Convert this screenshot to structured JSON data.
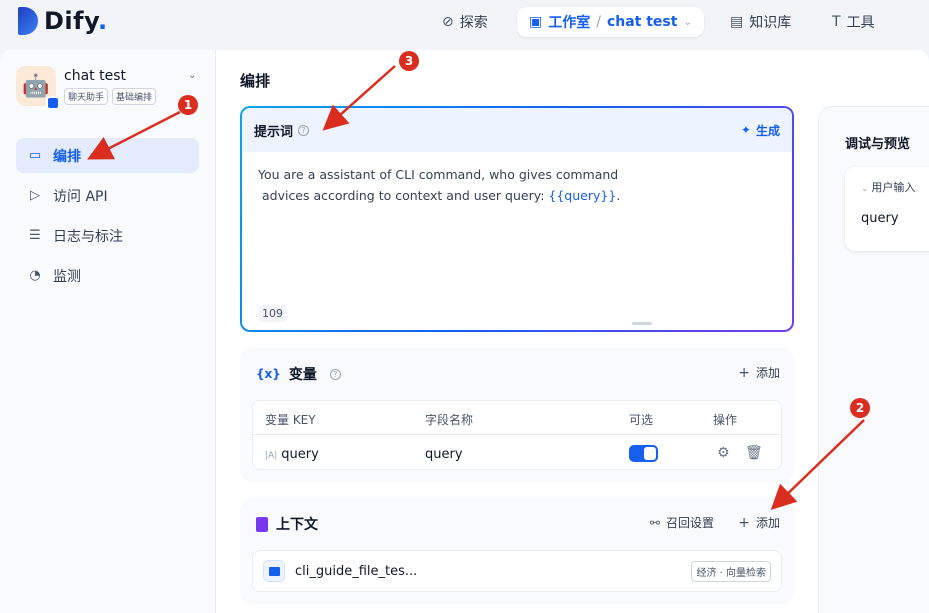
{
  "brand": {
    "logo_text": "Dify",
    "logo_dot": "."
  },
  "topnav": {
    "explore": "探索",
    "studio": "工作室",
    "studio_sep": "/",
    "app_name": "chat test",
    "knowledge": "知识库",
    "tools": "工具"
  },
  "app": {
    "name": "chat test",
    "tags": [
      "聊天助手",
      "基础编排"
    ]
  },
  "sidebar": {
    "items": [
      {
        "label": "编排",
        "icon": "layout-icon",
        "active": true
      },
      {
        "label": "访问 API",
        "icon": "terminal-icon",
        "active": false
      },
      {
        "label": "日志与标注",
        "icon": "log-icon",
        "active": false
      },
      {
        "label": "监测",
        "icon": "gauge-icon",
        "active": false
      }
    ]
  },
  "main": {
    "title": "编排",
    "prompt": {
      "title": "提示词",
      "generate_label": "生成",
      "text_line1": "You are a assistant of CLI command, who gives command",
      "text_line2": " advices according to context and user query: ",
      "variable": "{{query}}",
      "text_end": ".",
      "char_count": "109"
    },
    "variables": {
      "title": "变量",
      "icon_text": "{x}",
      "add_label": "添加",
      "columns": [
        "变量 KEY",
        "字段名称",
        "可选",
        "操作"
      ],
      "rows": [
        {
          "key_icon": "|A|",
          "key": "query",
          "field_name": "query",
          "optional": true
        }
      ]
    },
    "context": {
      "title": "上下文",
      "recall_label": "召回设置",
      "add_label": "添加",
      "datasets": [
        {
          "name": "cli_guide_file_tes...",
          "badge": "经济 · 向量检索"
        }
      ]
    }
  },
  "preview": {
    "title": "调试与预览",
    "user_input_label": "用户输入",
    "field_label": "query"
  },
  "annotations": [
    "1",
    "2",
    "3"
  ],
  "colors": {
    "accent": "#155eef",
    "annotation": "#d92d20"
  }
}
